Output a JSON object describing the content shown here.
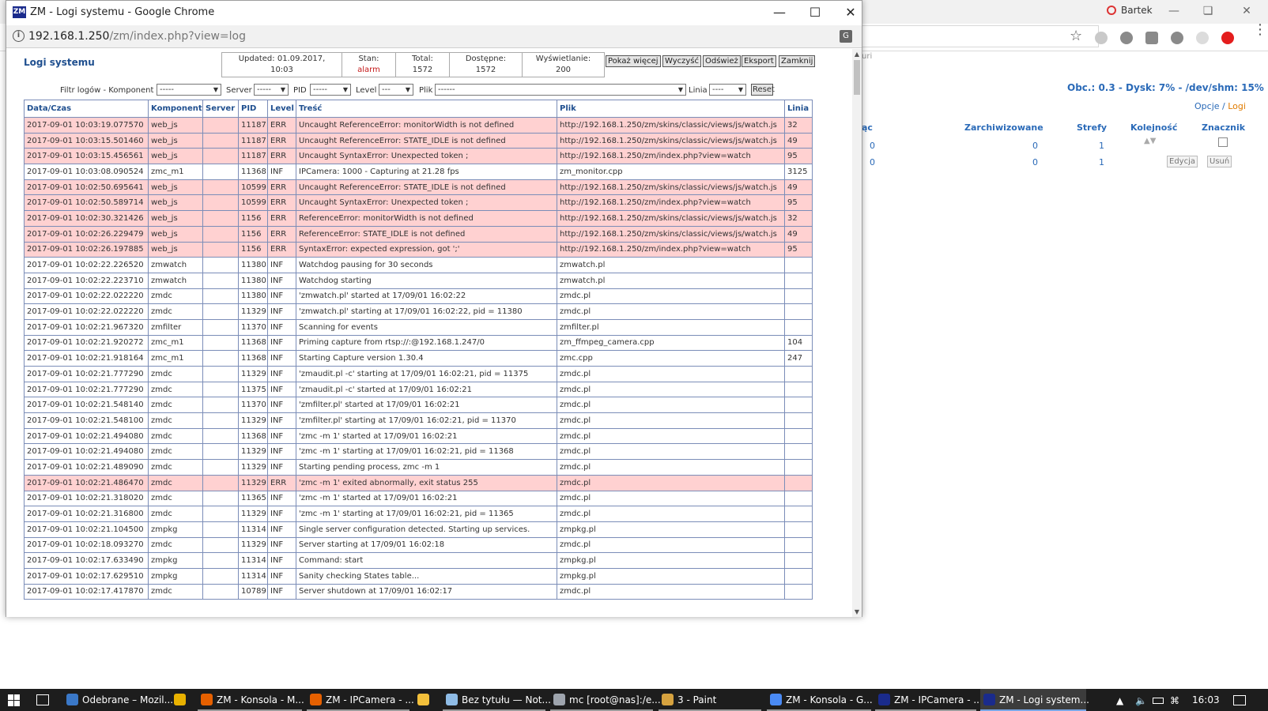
{
  "background": {
    "user_name": "Bartek",
    "stats": "Obc.: 0.3 - Dysk: 7% - /dev/shm: 15%",
    "options_link": "Opcje",
    "separator": "/",
    "logs_link": "Logi",
    "partial_header": "ąc",
    "headers": [
      "Zarchiwizowane",
      "Strefy",
      "Kolejność",
      "Znacznik"
    ],
    "row1": {
      "a": "0",
      "b": "0",
      "c": "1"
    },
    "row2": {
      "a": "0",
      "b": "0",
      "c": "1"
    },
    "edit_button": "Edycja",
    "delete_button": "Usuń",
    "tab_fragment": "uri"
  },
  "window": {
    "title": "ZM - Logi systemu - Google Chrome",
    "url_host": "192.168.1.250",
    "url_path": "/zm/index.php?view=log"
  },
  "page": {
    "heading": "Logi systemu",
    "info": {
      "updated_label": "Updated: 01.09.2017,",
      "updated_time": "10:03",
      "state_label": "Stan:",
      "state_value": "alarm",
      "total_label": "Total:",
      "total_value": "1572",
      "available_label": "Dostępne:",
      "available_value": "1572",
      "display_label": "Wyświetlanie:",
      "display_value": "200"
    },
    "buttons": {
      "show_more": "Pokaż więcej",
      "clear": "Wyczyść",
      "refresh": "Odśwież",
      "export": "Eksport",
      "close": "Zamknij"
    },
    "filters": {
      "title": "Filtr logów - Komponent",
      "component": "-----",
      "server_label": "Server",
      "server": "-----",
      "pid_label": "PID",
      "pid": "-----",
      "level_label": "Level",
      "level": "---",
      "file_label": "Plik",
      "file": "------",
      "line_label": "Linia",
      "line": "----",
      "reset": "Reset"
    },
    "columns": [
      "Data/Czas",
      "Komponent",
      "Server",
      "PID",
      "Level",
      "Treść",
      "Plik",
      "Linia"
    ],
    "rows": [
      {
        "dt": "2017-09-01 10:03:19.077570",
        "comp": "web_js",
        "srv": "",
        "pid": "11187",
        "lvl": "ERR",
        "msg": "Uncaught ReferenceError: monitorWidth is not defined",
        "file": "http://192.168.1.250/zm/skins/classic/views/js/watch.js",
        "line": "32"
      },
      {
        "dt": "2017-09-01 10:03:15.501460",
        "comp": "web_js",
        "srv": "",
        "pid": "11187",
        "lvl": "ERR",
        "msg": "Uncaught ReferenceError: STATE_IDLE is not defined",
        "file": "http://192.168.1.250/zm/skins/classic/views/js/watch.js",
        "line": "49"
      },
      {
        "dt": "2017-09-01 10:03:15.456561",
        "comp": "web_js",
        "srv": "",
        "pid": "11187",
        "lvl": "ERR",
        "msg": "Uncaught SyntaxError: Unexpected token ;",
        "file": "http://192.168.1.250/zm/index.php?view=watch",
        "line": "95"
      },
      {
        "dt": "2017-09-01 10:03:08.090524",
        "comp": "zmc_m1",
        "srv": "",
        "pid": "11368",
        "lvl": "INF",
        "msg": "IPCamera: 1000 - Capturing at 21.28 fps",
        "file": "zm_monitor.cpp",
        "line": "3125"
      },
      {
        "dt": "2017-09-01 10:02:50.695641",
        "comp": "web_js",
        "srv": "",
        "pid": "10599",
        "lvl": "ERR",
        "msg": "Uncaught ReferenceError: STATE_IDLE is not defined",
        "file": "http://192.168.1.250/zm/skins/classic/views/js/watch.js",
        "line": "49"
      },
      {
        "dt": "2017-09-01 10:02:50.589714",
        "comp": "web_js",
        "srv": "",
        "pid": "10599",
        "lvl": "ERR",
        "msg": "Uncaught SyntaxError: Unexpected token ;",
        "file": "http://192.168.1.250/zm/index.php?view=watch",
        "line": "95"
      },
      {
        "dt": "2017-09-01 10:02:30.321426",
        "comp": "web_js",
        "srv": "",
        "pid": "1156",
        "lvl": "ERR",
        "msg": "ReferenceError: monitorWidth is not defined",
        "file": "http://192.168.1.250/zm/skins/classic/views/js/watch.js",
        "line": "32"
      },
      {
        "dt": "2017-09-01 10:02:26.229479",
        "comp": "web_js",
        "srv": "",
        "pid": "1156",
        "lvl": "ERR",
        "msg": "ReferenceError: STATE_IDLE is not defined",
        "file": "http://192.168.1.250/zm/skins/classic/views/js/watch.js",
        "line": "49"
      },
      {
        "dt": "2017-09-01 10:02:26.197885",
        "comp": "web_js",
        "srv": "",
        "pid": "1156",
        "lvl": "ERR",
        "msg": "SyntaxError: expected expression, got ';'",
        "file": "http://192.168.1.250/zm/index.php?view=watch",
        "line": "95"
      },
      {
        "dt": "2017-09-01 10:02:22.226520",
        "comp": "zmwatch",
        "srv": "",
        "pid": "11380",
        "lvl": "INF",
        "msg": "Watchdog pausing for 30 seconds",
        "file": "zmwatch.pl",
        "line": ""
      },
      {
        "dt": "2017-09-01 10:02:22.223710",
        "comp": "zmwatch",
        "srv": "",
        "pid": "11380",
        "lvl": "INF",
        "msg": "Watchdog starting",
        "file": "zmwatch.pl",
        "line": ""
      },
      {
        "dt": "2017-09-01 10:02:22.022220",
        "comp": "zmdc",
        "srv": "",
        "pid": "11380",
        "lvl": "INF",
        "msg": "'zmwatch.pl' started at 17/09/01 16:02:22",
        "file": "zmdc.pl",
        "line": ""
      },
      {
        "dt": "2017-09-01 10:02:22.022220",
        "comp": "zmdc",
        "srv": "",
        "pid": "11329",
        "lvl": "INF",
        "msg": "'zmwatch.pl' starting at 17/09/01 16:02:22, pid = 11380",
        "file": "zmdc.pl",
        "line": ""
      },
      {
        "dt": "2017-09-01 10:02:21.967320",
        "comp": "zmfilter",
        "srv": "",
        "pid": "11370",
        "lvl": "INF",
        "msg": "Scanning for events",
        "file": "zmfilter.pl",
        "line": ""
      },
      {
        "dt": "2017-09-01 10:02:21.920272",
        "comp": "zmc_m1",
        "srv": "",
        "pid": "11368",
        "lvl": "INF",
        "msg": "Priming capture from rtsp://:@192.168.1.247/0",
        "file": "zm_ffmpeg_camera.cpp",
        "line": "104"
      },
      {
        "dt": "2017-09-01 10:02:21.918164",
        "comp": "zmc_m1",
        "srv": "",
        "pid": "11368",
        "lvl": "INF",
        "msg": "Starting Capture version 1.30.4",
        "file": "zmc.cpp",
        "line": "247"
      },
      {
        "dt": "2017-09-01 10:02:21.777290",
        "comp": "zmdc",
        "srv": "",
        "pid": "11329",
        "lvl": "INF",
        "msg": "'zmaudit.pl -c' starting at 17/09/01 16:02:21, pid = 11375",
        "file": "zmdc.pl",
        "line": ""
      },
      {
        "dt": "2017-09-01 10:02:21.777290",
        "comp": "zmdc",
        "srv": "",
        "pid": "11375",
        "lvl": "INF",
        "msg": "'zmaudit.pl -c' started at 17/09/01 16:02:21",
        "file": "zmdc.pl",
        "line": ""
      },
      {
        "dt": "2017-09-01 10:02:21.548140",
        "comp": "zmdc",
        "srv": "",
        "pid": "11370",
        "lvl": "INF",
        "msg": "'zmfilter.pl' started at 17/09/01 16:02:21",
        "file": "zmdc.pl",
        "line": ""
      },
      {
        "dt": "2017-09-01 10:02:21.548100",
        "comp": "zmdc",
        "srv": "",
        "pid": "11329",
        "lvl": "INF",
        "msg": "'zmfilter.pl' starting at 17/09/01 16:02:21, pid = 11370",
        "file": "zmdc.pl",
        "line": ""
      },
      {
        "dt": "2017-09-01 10:02:21.494080",
        "comp": "zmdc",
        "srv": "",
        "pid": "11368",
        "lvl": "INF",
        "msg": "'zmc -m 1' started at 17/09/01 16:02:21",
        "file": "zmdc.pl",
        "line": ""
      },
      {
        "dt": "2017-09-01 10:02:21.494080",
        "comp": "zmdc",
        "srv": "",
        "pid": "11329",
        "lvl": "INF",
        "msg": "'zmc -m 1' starting at 17/09/01 16:02:21, pid = 11368",
        "file": "zmdc.pl",
        "line": ""
      },
      {
        "dt": "2017-09-01 10:02:21.489090",
        "comp": "zmdc",
        "srv": "",
        "pid": "11329",
        "lvl": "INF",
        "msg": "Starting pending process, zmc -m 1",
        "file": "zmdc.pl",
        "line": ""
      },
      {
        "dt": "2017-09-01 10:02:21.486470",
        "comp": "zmdc",
        "srv": "",
        "pid": "11329",
        "lvl": "ERR",
        "msg": "'zmc -m 1' exited abnormally, exit status 255",
        "file": "zmdc.pl",
        "line": ""
      },
      {
        "dt": "2017-09-01 10:02:21.318020",
        "comp": "zmdc",
        "srv": "",
        "pid": "11365",
        "lvl": "INF",
        "msg": "'zmc -m 1' started at 17/09/01 16:02:21",
        "file": "zmdc.pl",
        "line": ""
      },
      {
        "dt": "2017-09-01 10:02:21.316800",
        "comp": "zmdc",
        "srv": "",
        "pid": "11329",
        "lvl": "INF",
        "msg": "'zmc -m 1' starting at 17/09/01 16:02:21, pid = 11365",
        "file": "zmdc.pl",
        "line": ""
      },
      {
        "dt": "2017-09-01 10:02:21.104500",
        "comp": "zmpkg",
        "srv": "",
        "pid": "11314",
        "lvl": "INF",
        "msg": "Single server configuration detected. Starting up services.",
        "file": "zmpkg.pl",
        "line": ""
      },
      {
        "dt": "2017-09-01 10:02:18.093270",
        "comp": "zmdc",
        "srv": "",
        "pid": "11329",
        "lvl": "INF",
        "msg": "Server starting at 17/09/01 16:02:18",
        "file": "zmdc.pl",
        "line": ""
      },
      {
        "dt": "2017-09-01 10:02:17.633490",
        "comp": "zmpkg",
        "srv": "",
        "pid": "11314",
        "lvl": "INF",
        "msg": "Command: start",
        "file": "zmpkg.pl",
        "line": ""
      },
      {
        "dt": "2017-09-01 10:02:17.629510",
        "comp": "zmpkg",
        "srv": "",
        "pid": "11314",
        "lvl": "INF",
        "msg": "Sanity checking States table...",
        "file": "zmpkg.pl",
        "line": ""
      },
      {
        "dt": "2017-09-01 10:02:17.417870",
        "comp": "zmdc",
        "srv": "",
        "pid": "10789",
        "lvl": "INF",
        "msg": "Server shutdown at 17/09/01 16:02:17",
        "file": "zmdc.pl",
        "line": ""
      }
    ]
  },
  "taskbar": {
    "items": [
      {
        "label": "Odebrane – Mozil...",
        "icon": "thunderbird-icon",
        "color": "#3a78c8"
      },
      {
        "label": "",
        "icon": "winamp-icon",
        "color": "#e8b100"
      },
      {
        "label": "ZM - Konsola - M...",
        "icon": "firefox-icon",
        "color": "#e66000"
      },
      {
        "label": "ZM - IPCamera - ...",
        "icon": "firefox-icon",
        "color": "#e66000"
      },
      {
        "label": "",
        "icon": "folder-icon",
        "color": "#f3c03b"
      },
      {
        "label": "Bez tytułu — Not...",
        "icon": "notepad-icon",
        "color": "#8fbce6"
      },
      {
        "label": "mc [root@nas]:/e...",
        "icon": "putty-icon",
        "color": "#9ea4ad"
      },
      {
        "label": "3 - Paint",
        "icon": "paint-icon",
        "color": "#d6a23f"
      },
      {
        "label": "ZM - Konsola - G...",
        "icon": "chrome-icon",
        "color": "#4a8af4"
      },
      {
        "label": "ZM - IPCamera - ...",
        "icon": "zm-icon",
        "color": "#1a2b8c"
      },
      {
        "label": "ZM - Logi system...",
        "icon": "zm-icon",
        "color": "#1a2b8c"
      }
    ],
    "clock": "16:03"
  }
}
